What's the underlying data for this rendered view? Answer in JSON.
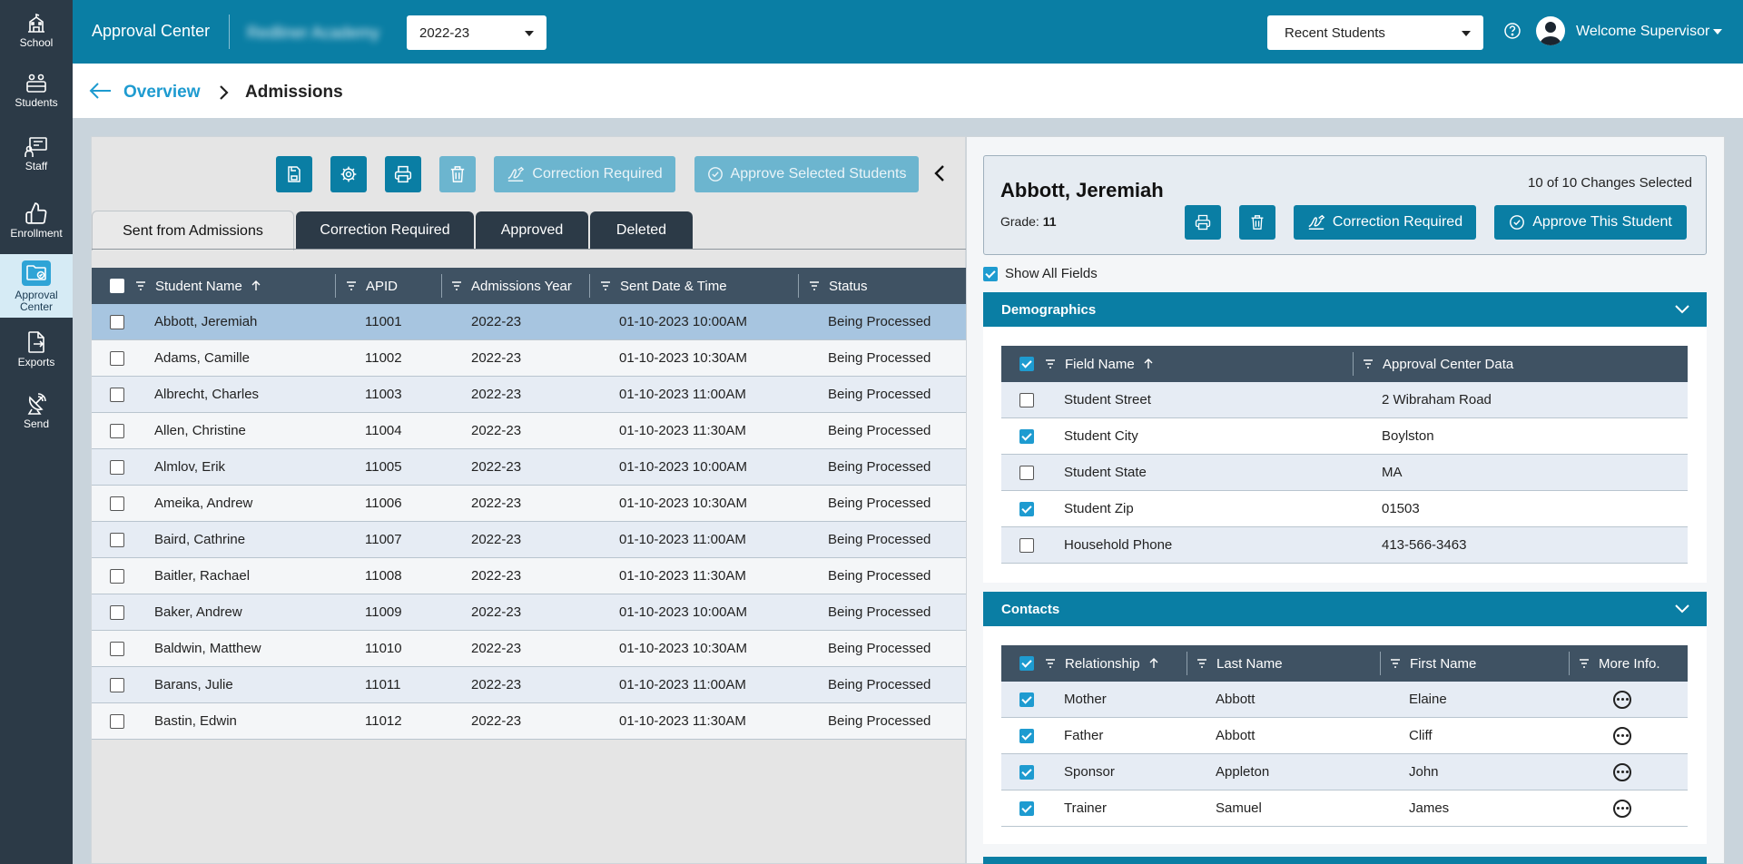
{
  "sidebar": {
    "items": [
      {
        "label": "School",
        "icon": "school-icon"
      },
      {
        "label": "Students",
        "icon": "students-icon"
      },
      {
        "label": "Staff",
        "icon": "staff-icon"
      },
      {
        "label": "Enrollment",
        "icon": "thumbs-up-icon"
      },
      {
        "label": "Approval Center",
        "icon": "folder-check-icon",
        "active": true
      },
      {
        "label": "Exports",
        "icon": "export-icon"
      },
      {
        "label": "Send",
        "icon": "satellite-dish-icon"
      }
    ]
  },
  "topbar": {
    "app_title": "Approval Center",
    "school_name": "Redliner Academy",
    "year_select": "2022-23",
    "recent_select": "Recent Students",
    "welcome": "Welcome Supervisor"
  },
  "breadcrumb": {
    "parent": "Overview",
    "current": "Admissions"
  },
  "toolbar": {
    "correction_label": "Correction Required",
    "approve_selected_label": "Approve Selected Students"
  },
  "tabs": [
    "Sent from Admissions",
    "Correction Required",
    "Approved",
    "Deleted"
  ],
  "students_table": {
    "headers": [
      "Student Name",
      "APID",
      "Admissions Year",
      "Sent Date & Time",
      "Status"
    ],
    "rows": [
      {
        "name": "Abbott, Jeremiah",
        "apid": "11001",
        "year": "2022-23",
        "sent": "01-10-2023 10:00AM",
        "status": "Being Processed",
        "selected": true
      },
      {
        "name": "Adams, Camille",
        "apid": "11002",
        "year": "2022-23",
        "sent": "01-10-2023 10:30AM",
        "status": "Being Processed"
      },
      {
        "name": "Albrecht, Charles",
        "apid": "11003",
        "year": "2022-23",
        "sent": "01-10-2023 11:00AM",
        "status": "Being Processed"
      },
      {
        "name": "Allen, Christine",
        "apid": "11004",
        "year": "2022-23",
        "sent": "01-10-2023 11:30AM",
        "status": "Being Processed"
      },
      {
        "name": "Almlov, Erik",
        "apid": "11005",
        "year": "2022-23",
        "sent": "01-10-2023 10:00AM",
        "status": "Being Processed"
      },
      {
        "name": "Ameika, Andrew",
        "apid": "11006",
        "year": "2022-23",
        "sent": "01-10-2023 10:30AM",
        "status": "Being Processed"
      },
      {
        "name": "Baird, Cathrine",
        "apid": "11007",
        "year": "2022-23",
        "sent": "01-10-2023 11:00AM",
        "status": "Being Processed"
      },
      {
        "name": "Baitler, Rachael",
        "apid": "11008",
        "year": "2022-23",
        "sent": "01-10-2023 11:30AM",
        "status": "Being Processed"
      },
      {
        "name": "Baker, Andrew",
        "apid": "11009",
        "year": "2022-23",
        "sent": "01-10-2023 10:00AM",
        "status": "Being Processed"
      },
      {
        "name": "Baldwin, Matthew",
        "apid": "11010",
        "year": "2022-23",
        "sent": "01-10-2023 10:30AM",
        "status": "Being Processed"
      },
      {
        "name": "Barans, Julie",
        "apid": "11011",
        "year": "2022-23",
        "sent": "01-10-2023 11:00AM",
        "status": "Being Processed"
      },
      {
        "name": "Bastin, Edwin",
        "apid": "11012",
        "year": "2022-23",
        "sent": "01-10-2023 11:30AM",
        "status": "Being Processed"
      }
    ]
  },
  "student_detail": {
    "name": "Abbott, Jeremiah",
    "grade_label": "Grade:",
    "grade_value": "11",
    "changes_selected": "10 of 10 Changes Selected",
    "correction_label": "Correction Required",
    "approve_label": "Approve This Student",
    "show_all_label": "Show All Fields"
  },
  "demographics": {
    "title": "Demographics",
    "headers": [
      "Field Name",
      "Approval Center Data"
    ],
    "rows": [
      {
        "field": "Student Street",
        "value": "2 Wibraham Road",
        "checked": false
      },
      {
        "field": "Student City",
        "value": "Boylston",
        "checked": true
      },
      {
        "field": "Student State",
        "value": "MA",
        "checked": false
      },
      {
        "field": "Student Zip",
        "value": "01503",
        "checked": true
      },
      {
        "field": "Household Phone",
        "value": "413-566-3463",
        "checked": false
      }
    ]
  },
  "contacts": {
    "title": "Contacts",
    "headers": [
      "Relationship",
      "Last Name",
      "First Name",
      "More Info."
    ],
    "rows": [
      {
        "relationship": "Mother",
        "last": "Abbott",
        "first": "Elaine"
      },
      {
        "relationship": "Father",
        "last": "Abbott",
        "first": "Cliff"
      },
      {
        "relationship": "Sponsor",
        "last": "Appleton",
        "first": "John"
      },
      {
        "relationship": "Trainer",
        "last": "Samuel",
        "first": "James"
      }
    ]
  },
  "colors": {
    "primary": "#0a7ea4",
    "sidebar": "#2c3a47",
    "table_header": "#3f5263",
    "selected_row": "#a7c5e0",
    "row_alt": "#e6ecf4",
    "accent": "#1e9bd0"
  }
}
